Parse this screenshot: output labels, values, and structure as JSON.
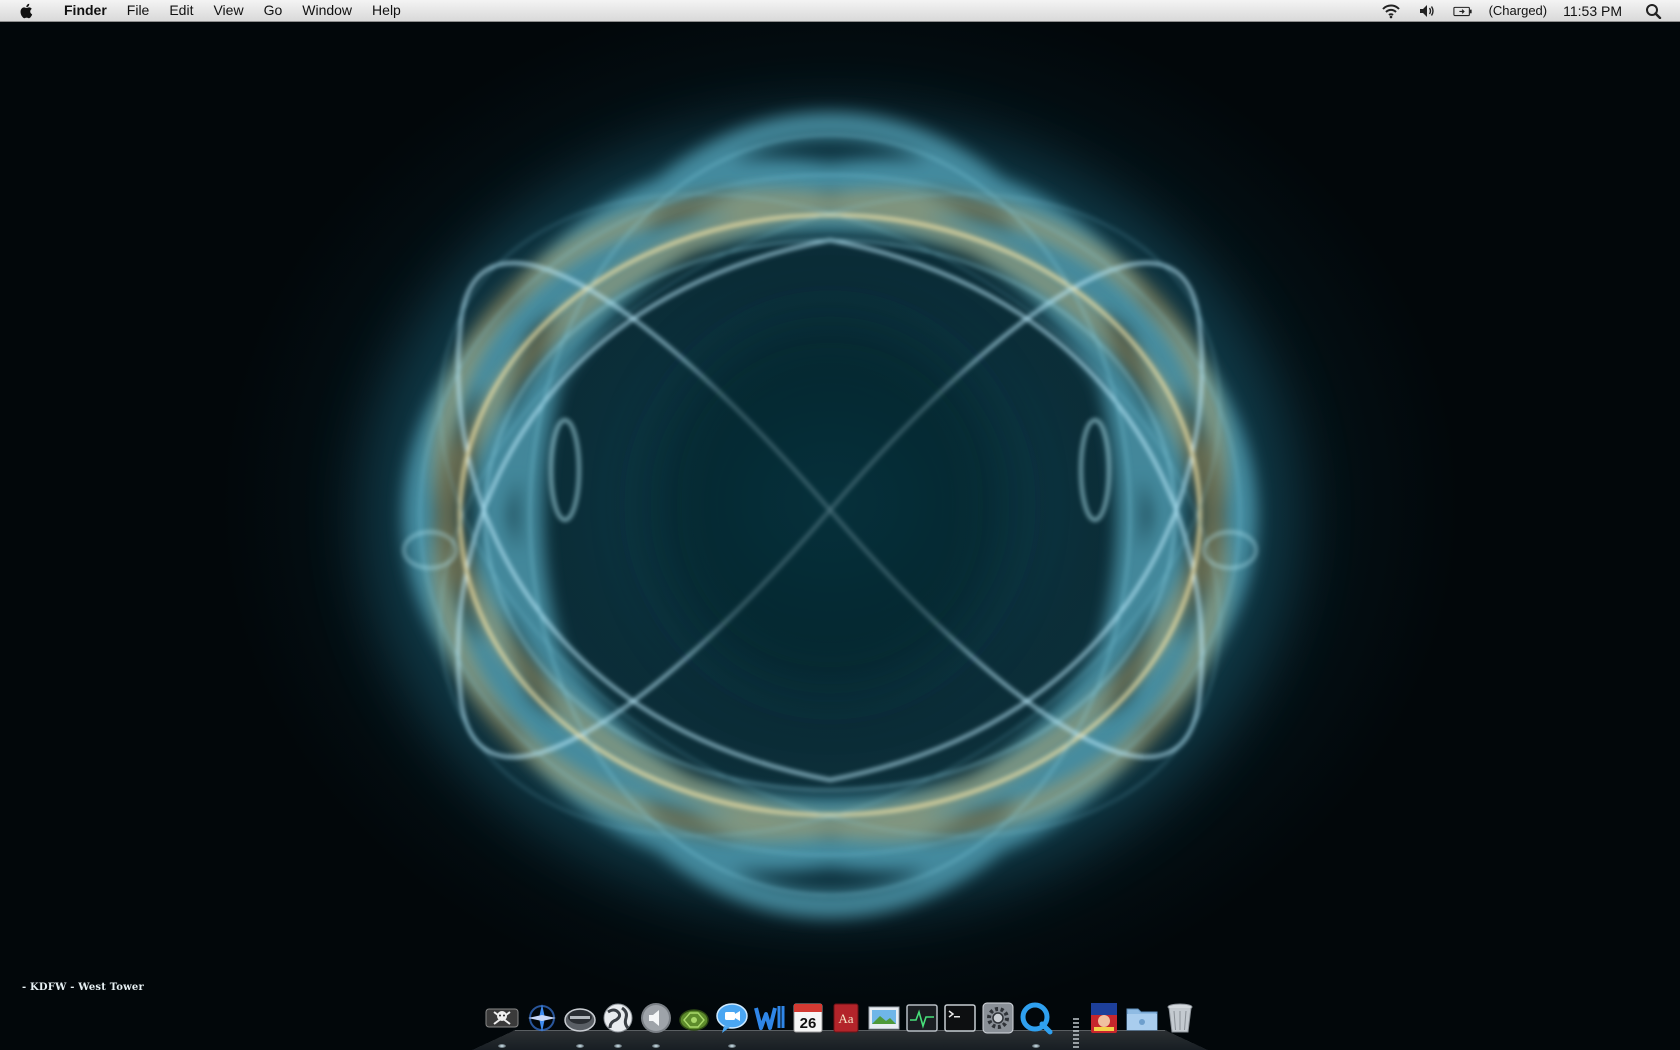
{
  "menubar": {
    "app_name": "Finder",
    "menus": [
      "File",
      "Edit",
      "View",
      "Go",
      "Window",
      "Help"
    ],
    "status": {
      "battery_text": "(Charged)",
      "clock": "11:53 PM"
    }
  },
  "desktop": {
    "label": "- KDFW - West Tower"
  },
  "dock": {
    "items": [
      {
        "icon": "pirate-app-icon",
        "running": true
      },
      {
        "icon": "compass-app-icon",
        "running": false
      },
      {
        "icon": "hard-drive-icon",
        "running": true
      },
      {
        "icon": "globe-icon",
        "running": true
      },
      {
        "icon": "speaker-icon",
        "running": true
      },
      {
        "icon": "turtle-app-icon",
        "running": false
      },
      {
        "icon": "ichat-icon",
        "running": true
      },
      {
        "icon": "word-processor-icon",
        "running": false
      },
      {
        "icon": "ical-icon",
        "running": false,
        "day": "26"
      },
      {
        "icon": "dictionary-icon",
        "running": false,
        "text": "Aa"
      },
      {
        "icon": "preview-icon",
        "running": false
      },
      {
        "icon": "activity-monitor-icon",
        "running": false
      },
      {
        "icon": "terminal-icon",
        "running": false
      },
      {
        "icon": "system-preferences-icon",
        "running": false
      },
      {
        "icon": "quicktime-icon",
        "running": true
      },
      {
        "icon": "game-app-icon",
        "running": false
      },
      {
        "icon": "folder-icon",
        "running": false
      },
      {
        "icon": "trash-icon",
        "running": false
      }
    ]
  },
  "colors": {
    "glow": "#7fd8f0",
    "gold": "#f3d98a",
    "deep": "#0b2b35"
  }
}
